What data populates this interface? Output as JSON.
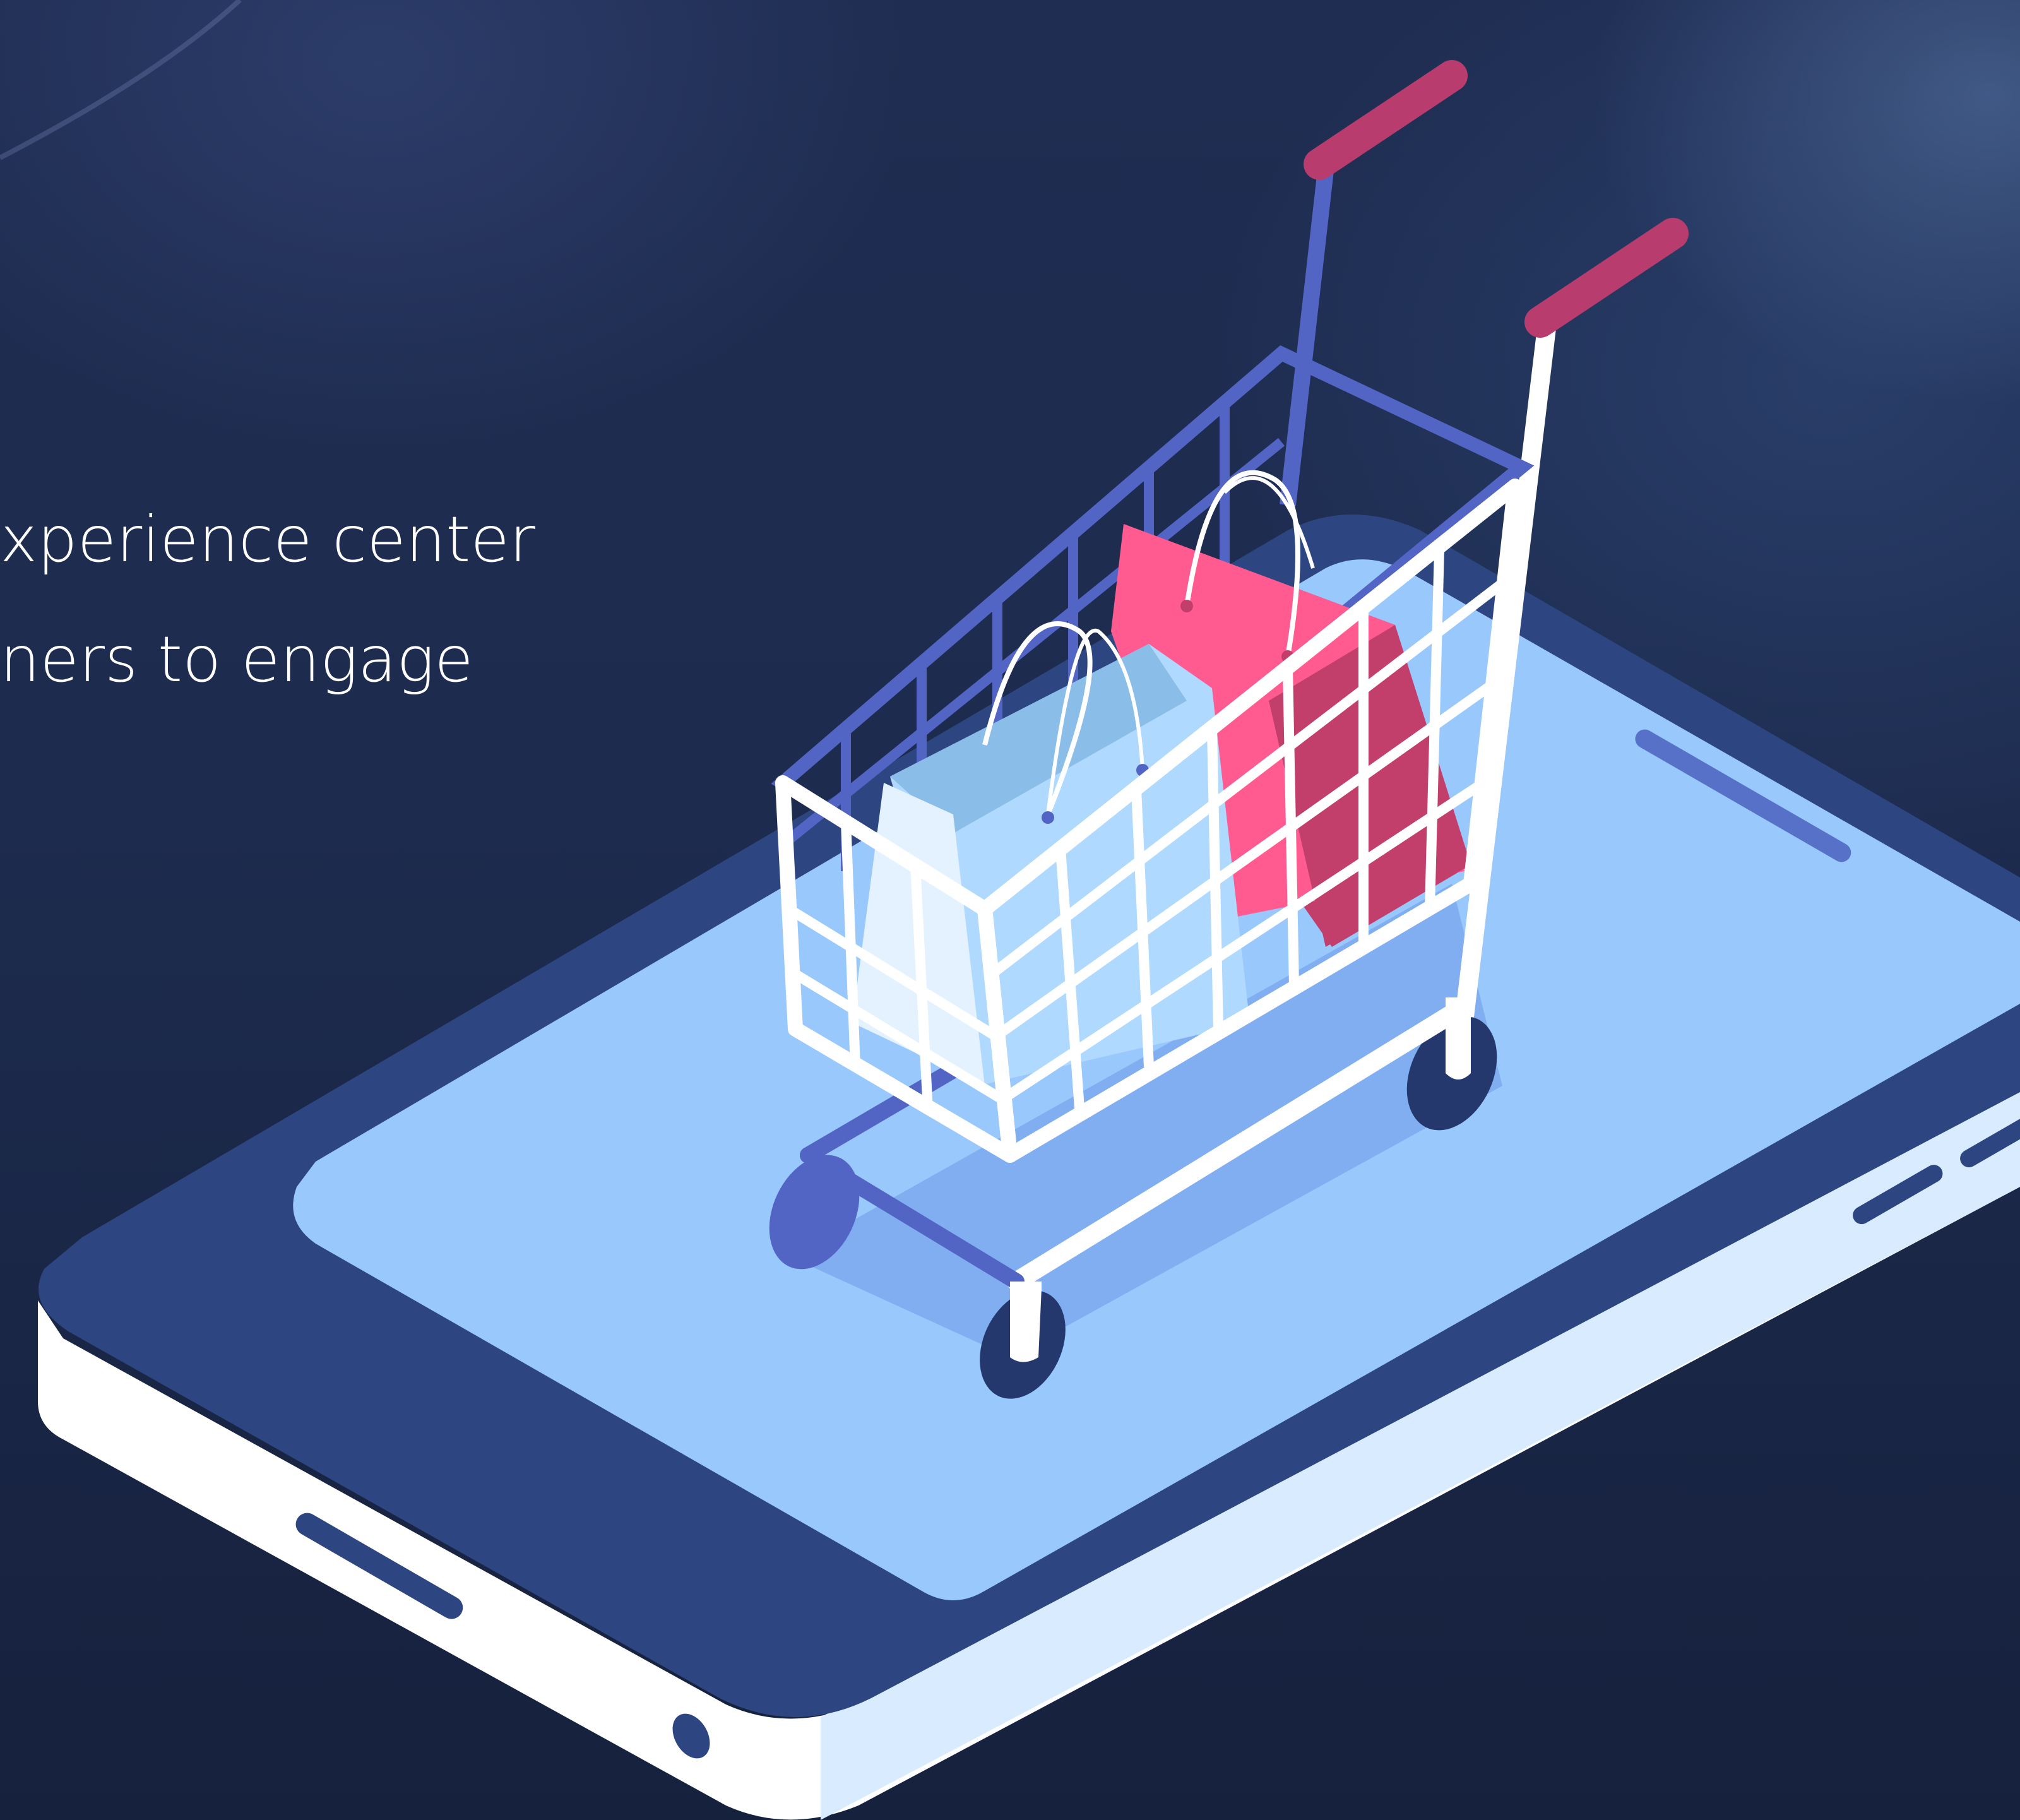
{
  "hero": {
    "line1": "xperience center",
    "line2": "ners to engage"
  },
  "illustration": {
    "subject": "shopping-cart-on-smartphone",
    "colors": {
      "background": "#1d2b4e",
      "phone_body": "#2d4682",
      "phone_edge": "#ffffff",
      "screen": "#99c8fd",
      "screen_shadow": "#80aef0",
      "cart_frame_back": "#5264c4",
      "cart_frame_front": "#ffffff",
      "cart_handle": "#b83d6e",
      "bag_pink": "#ff5b91",
      "bag_pink_dark": "#c23f6c",
      "bag_blue": "#afd9ff",
      "bag_blue_dark": "#8bbde9",
      "bag_white": "#e4f2ff",
      "wheel": "#24386e"
    }
  }
}
